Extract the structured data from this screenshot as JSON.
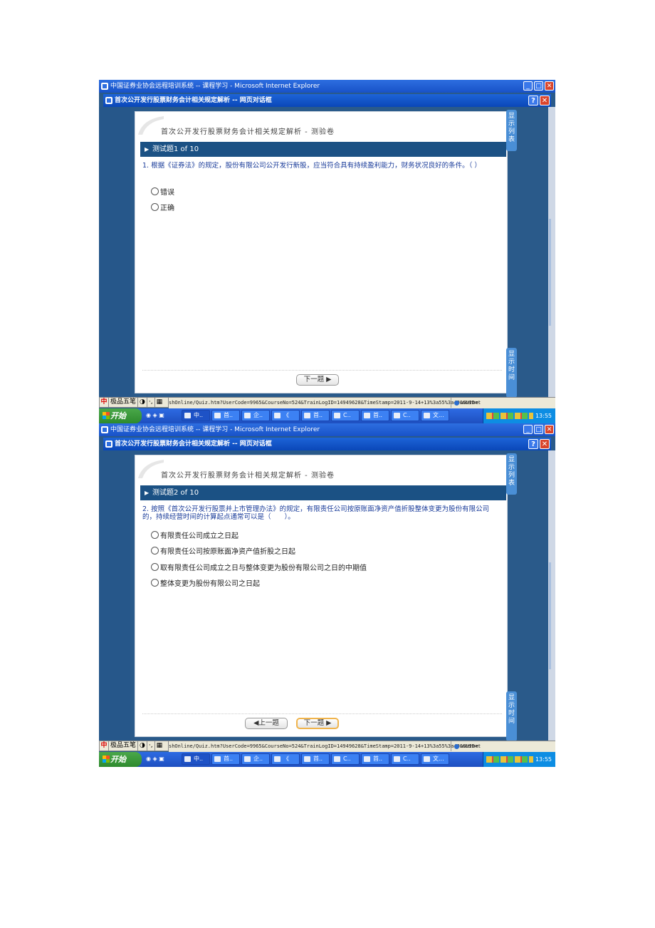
{
  "shots": [
    {
      "ie_title": "中国证券业协会远程培训系统 -- 课程学习 - Microsoft Internet Explorer",
      "dialog_title": "首次公开发行股票财务会计相关规定解析 -- 网页对话框",
      "page_title": "首次公开发行股票财务会计相关规定解析 - 测验卷",
      "question_header": "测试题1 of 10",
      "question": "1. 根据《证券法》的规定，股份有限公司公开发行新股，应当符合具有持续盈利能力，财务状况良好的条件。（ ）",
      "options": [
        "错误",
        "正确"
      ],
      "buttons": {
        "prev": "",
        "next": "下一题"
      },
      "tab_list": [
        "显",
        "示",
        "列",
        "表"
      ],
      "tab_time": [
        "显",
        "示",
        "时",
        "间"
      ],
      "ime": {
        "logo": "中",
        "name": "极品五笔",
        "a": "◑",
        "b": "·,",
        "c": "▦"
      },
      "status_url": "shOnline/Quiz.htm?UserCode=9965&CourseNo=524&TrainLogID=14949628&TimeStamp=2011-9-14+13%3a55%3a49&GUID=",
      "zone": "Internet",
      "start": "开始",
      "tasks": [
        "中..",
        "首..",
        "企..",
        "《",
        "首..",
        "C..",
        "首..",
        "C..",
        "文..."
      ],
      "clock": "13:55"
    },
    {
      "ie_title": "中国证券业协会远程培训系统 -- 课程学习 - Microsoft Internet Explorer",
      "dialog_title": "首次公开发行股票财务会计相关规定解析 -- 网页对话框",
      "page_title": "首次公开发行股票财务会计相关规定解析 - 测验卷",
      "question_header": "测试题2 of 10",
      "question": "2. 按照《首次公开发行股票并上市管理办法》的规定，有限责任公司按原账面净资产值折股整体变更为股份有限公司的，持续经营时间的计算起点通常可以是（　　）。",
      "options": [
        "有限责任公司成立之日起",
        "有限责任公司按原账面净资产值折股之日起",
        "取有限责任公司成立之日与整体变更为股份有限公司之日的中期值",
        "整体变更为股份有限公司之日起"
      ],
      "buttons": {
        "prev": "上一题",
        "next": "下一题"
      },
      "tab_list": [
        "显",
        "示",
        "列",
        "表"
      ],
      "tab_time": [
        "显",
        "示",
        "时",
        "间"
      ],
      "ime": {
        "logo": "中",
        "name": "极品五笔",
        "a": "◑",
        "b": "·,",
        "c": "▦"
      },
      "status_url": "shOnline/Quiz.htm?UserCode=9965&CourseNo=524&TrainLogID=14949628&TimeStamp=2011-9-14+13%3a55%3a49&GUID=",
      "zone": "Internet",
      "start": "开始",
      "tasks": [
        "中..",
        "首..",
        "企..",
        "《",
        "首..",
        "C..",
        "首..",
        "C..",
        "文..."
      ],
      "clock": "13:55"
    }
  ],
  "colors": {
    "question_bar": "#1b5184",
    "dialog_bar": "#0a47b8",
    "question_text": "#1a3c9a",
    "tab": "#4a8fd6",
    "start": "#2e8a2e"
  }
}
